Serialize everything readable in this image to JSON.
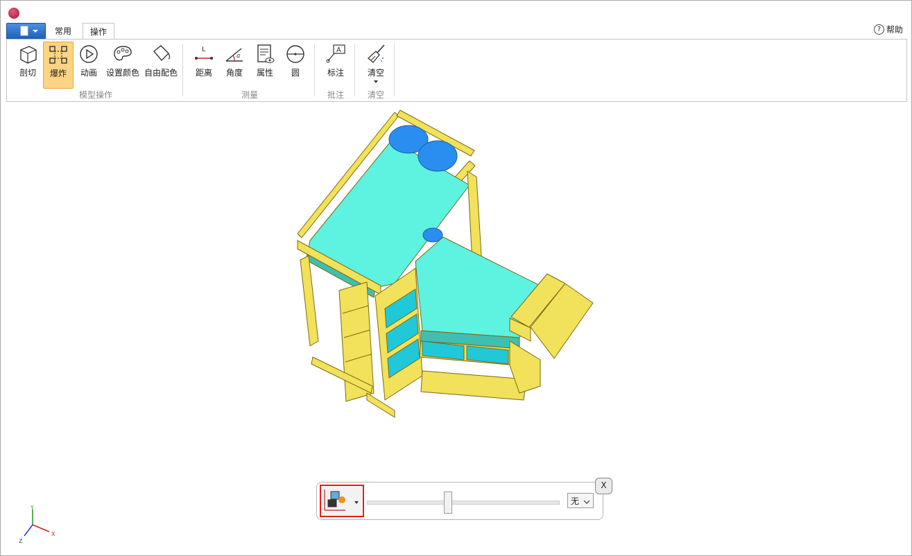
{
  "tabs": [
    {
      "label": "常用",
      "active": false
    },
    {
      "label": "操作",
      "active": true
    }
  ],
  "help": {
    "label": "帮助"
  },
  "ribbon": {
    "groups": [
      {
        "label": "模型操作",
        "buttons": [
          "剖切",
          "爆炸",
          "动画",
          "设置颜色",
          "自由配色"
        ],
        "active": "爆炸"
      },
      {
        "label": "测量",
        "buttons": [
          "距离",
          "角度",
          "属性",
          "圆"
        ]
      },
      {
        "label": "批注",
        "buttons": [
          "标注"
        ]
      },
      {
        "label": "清空",
        "buttons": [
          "清空"
        ]
      }
    ]
  },
  "icons": {
    "measure_distance_letter": "L",
    "angle_letter": "a",
    "annotation_letter": "A"
  },
  "explode_toolbar": {
    "mode_icon": "explode-mode-icon",
    "slider_value": 0.42,
    "select_value": "无",
    "close_label": "X"
  },
  "axis": {
    "x": "X",
    "y": "Y",
    "z": "Z"
  },
  "colors": {
    "accent": "#fdd384",
    "frame": "#f2e15a",
    "mattress": "#5ef2e0",
    "pillow": "#2a8ef0",
    "highlight_border": "#e02020"
  }
}
